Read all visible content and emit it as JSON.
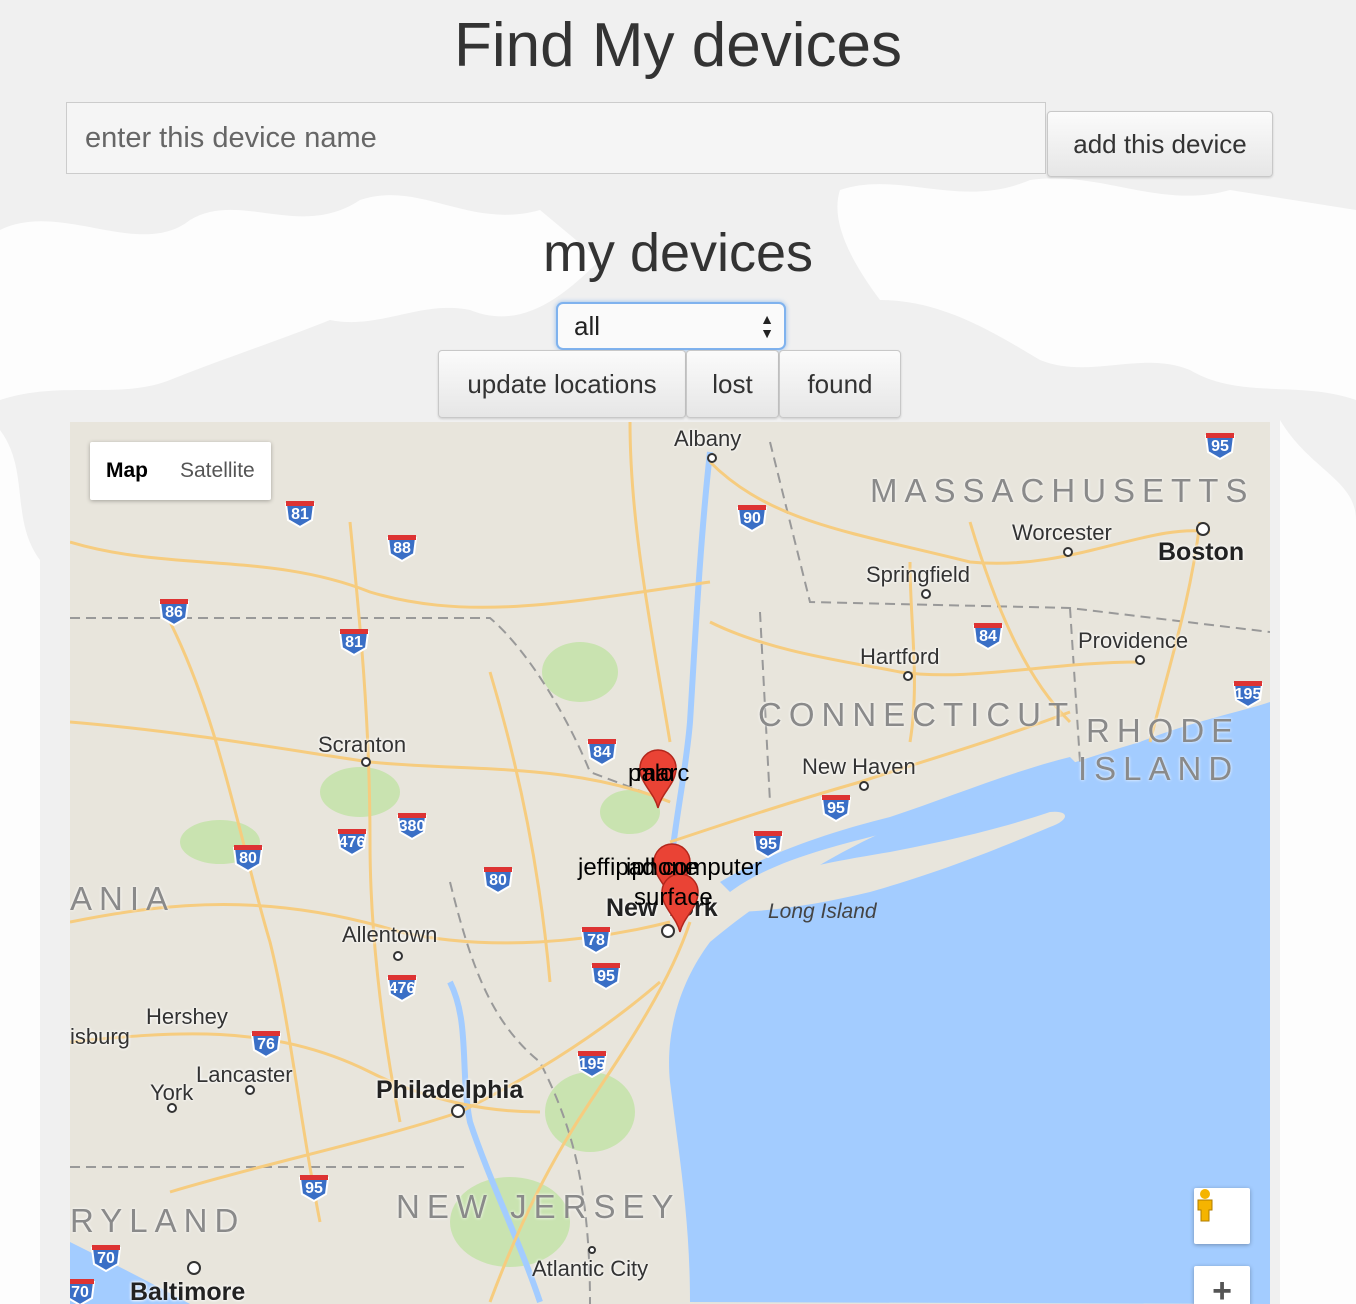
{
  "header": {
    "title": "Find My devices"
  },
  "add_form": {
    "placeholder": "enter this device name",
    "button_label": "add this device"
  },
  "devices_section": {
    "title": "my devices",
    "filter": {
      "selected": "all"
    },
    "buttons": {
      "update": "update locations",
      "lost": "lost",
      "found": "found"
    }
  },
  "map": {
    "type_controls": {
      "map": "Map",
      "satellite": "Satellite"
    },
    "zoom_in": "+",
    "cities": [
      "Albany",
      "Worcester",
      "Boston",
      "Springfield",
      "Hartford",
      "Providence",
      "Scranton",
      "New Haven",
      "Allentown",
      "Hershey",
      "Lancaster",
      "York",
      "Philadelphia",
      "Atlantic City",
      "Baltimore",
      "New York",
      "isburg"
    ],
    "states": [
      "MASSACHUSETTS",
      "CONNECTICUT",
      "RHODE",
      "ISLAND",
      "ANIA",
      "NEW JERSEY",
      "RYLAND"
    ],
    "water": [
      "Long Island"
    ],
    "highways": [
      "95",
      "81",
      "88",
      "90",
      "86",
      "81",
      "84",
      "84",
      "195",
      "84",
      "95",
      "476",
      "380",
      "95",
      "80",
      "80",
      "78",
      "95",
      "476",
      "76",
      "195",
      "95",
      "70",
      "70"
    ],
    "device_labels": [
      "palo",
      "marc",
      "jeff",
      "ipad",
      "iphone",
      "computer",
      "surface"
    ]
  }
}
